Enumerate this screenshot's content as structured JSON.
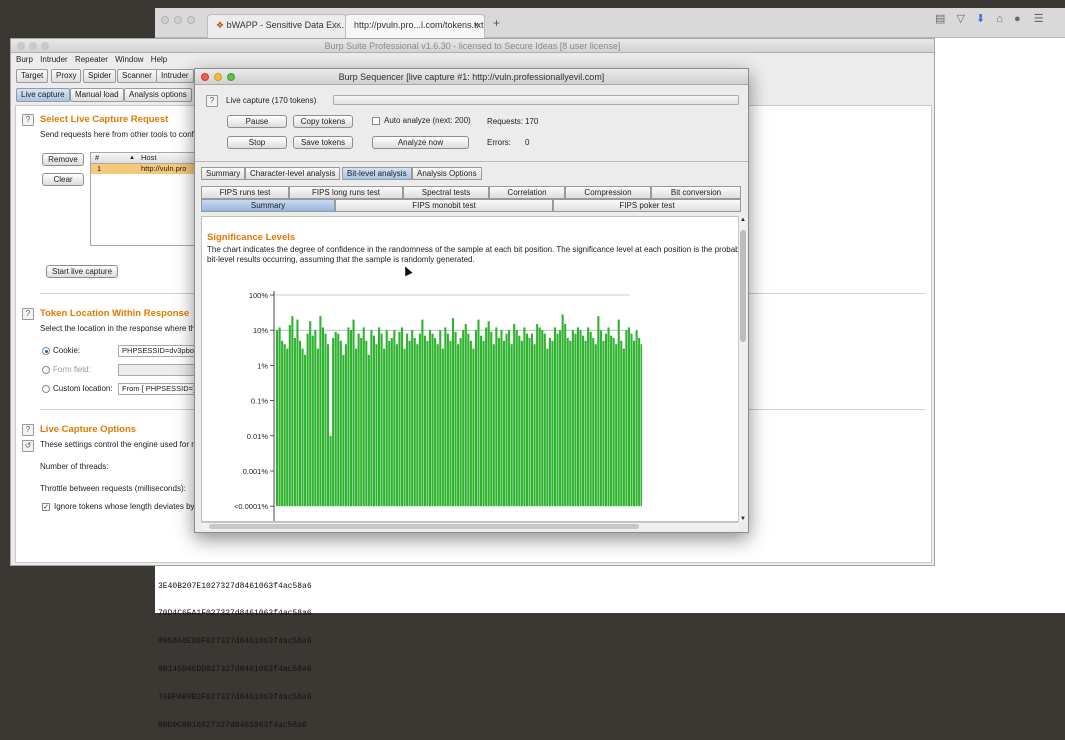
{
  "browser": {
    "tabs": [
      {
        "label": "bWAPP - Sensitive Data Ex...",
        "close": "×"
      },
      {
        "label": "http://pvuln.pro...l.com/tokens.txt",
        "close": "×"
      }
    ],
    "new_tab": "+",
    "token_lines": [
      "3E40B207E1027327d8461063f4ac58a6",
      "70D4C6EA1F027327d8461063f4ac58a6",
      "095868E86F027327d8461063f4ac58a6",
      "9B145D46DD027327d8461063f4ac58a6",
      "76BPAB9B3F027327d8461063f4ac58a6",
      "8BD0C0B16027327d8461063f4ac58a6"
    ]
  },
  "burp": {
    "title": "Burp Suite Professional v1.6.30 - licensed to Secure Ideas [8 user license]",
    "menu": [
      "Burp",
      "Intruder",
      "Repeater",
      "Window",
      "Help"
    ],
    "main_tabs": [
      "Target",
      "Proxy",
      "Spider",
      "Scanner",
      "Intruder"
    ],
    "sub_tabs": [
      "Live capture",
      "Manual load",
      "Analysis options"
    ],
    "select_section": {
      "title": "Select Live Capture Request",
      "desc": "Send requests here from other tools to conf",
      "remove": "Remove",
      "clear": "Clear",
      "col_num": "#",
      "col_host": "Host",
      "row_num": "1",
      "row_host": "http://vuln.pro",
      "start": "Start live capture"
    },
    "token_section": {
      "title": "Token Location Within Response",
      "desc": "Select the location in the response where the",
      "cookie_label": "Cookie:",
      "cookie_value": "PHPSESSID=dv3pboa",
      "form_label": "Form field:",
      "custom_label": "Custom location:",
      "custom_value": "From [ PHPSESSID=] to"
    },
    "options_section": {
      "title": "Live Capture Options",
      "desc": "These settings control the engine used for m",
      "threads": "Number of threads:",
      "throttle": "Throttle between requests (milliseconds):",
      "ignore": "Ignore tokens whose length deviates by"
    }
  },
  "sequencer": {
    "title": "Burp Sequencer [live capture #1: http://vuln.professionallyevil.com]",
    "capture_status": "Live capture (170 tokens)",
    "pause": "Pause",
    "copy_tokens": "Copy tokens",
    "stop": "Stop",
    "save_tokens": "Save tokens",
    "auto_analyze": "Auto analyze (next: 200)",
    "analyze_now": "Analyze now",
    "requests_label": "Requests:",
    "requests_value": "170",
    "errors_label": "Errors:",
    "errors_value": "0",
    "analysis_tabs": [
      "Summary",
      "Character-level analysis",
      "Bit-level analysis",
      "Analysis Options"
    ],
    "test_tabs_row1": [
      "FIPS runs test",
      "FIPS long runs test",
      "Spectral tests",
      "Correlation",
      "Compression",
      "Bit conversion"
    ],
    "test_tabs_row2": [
      "Summary",
      "FIPS monobit test",
      "FIPS poker test"
    ],
    "heading": "Significance Levels",
    "description_1": "The chart indicates the degree of confidence in the randomness of the sample at each bit position. The significance level at each position is the probab",
    "description_2": "bit-level results occurring, assuming that the sample is randomly generated."
  },
  "colors": {
    "accent": "#e07a00",
    "bar": "#2eb32e",
    "selected_tab": "#a9c3e4"
  },
  "chart_data": {
    "type": "bar",
    "y_scale": "log",
    "ylim": [
      1e-06,
      1
    ],
    "y_ticks": [
      "100%",
      "10%",
      "1%",
      "0.1%",
      "0.01%",
      "0.001%",
      "<0.0001%"
    ],
    "grid": true,
    "values": [
      0.1,
      0.12,
      0.05,
      0.04,
      0.03,
      0.14,
      0.25,
      0.06,
      0.2,
      0.05,
      0.03,
      0.02,
      0.08,
      0.18,
      0.07,
      0.1,
      0.03,
      0.25,
      0.12,
      0.08,
      0.04,
      0.0001,
      0.06,
      0.09,
      0.08,
      0.05,
      0.02,
      0.04,
      0.12,
      0.1,
      0.2,
      0.03,
      0.08,
      0.06,
      0.12,
      0.05,
      0.02,
      0.1,
      0.07,
      0.04,
      0.12,
      0.08,
      0.03,
      0.1,
      0.05,
      0.06,
      0.1,
      0.04,
      0.09,
      0.12,
      0.03,
      0.08,
      0.05,
      0.1,
      0.06,
      0.04,
      0.08,
      0.2,
      0.07,
      0.05,
      0.1,
      0.08,
      0.06,
      0.04,
      0.1,
      0.03,
      0.12,
      0.08,
      0.05,
      0.22,
      0.09,
      0.04,
      0.06,
      0.1,
      0.15,
      0.08,
      0.05,
      0.03,
      0.1,
      0.2,
      0.07,
      0.05,
      0.12,
      0.18,
      0.09,
      0.04,
      0.12,
      0.06,
      0.1,
      0.05,
      0.08,
      0.1,
      0.04,
      0.15,
      0.1,
      0.07,
      0.05,
      0.12,
      0.08,
      0.06,
      0.08,
      0.04,
      0.15,
      0.12,
      0.1,
      0.08,
      0.03,
      0.06,
      0.05,
      0.12,
      0.08,
      0.1,
      0.28,
      0.15,
      0.06,
      0.05,
      0.1,
      0.08,
      0.12,
      0.1,
      0.07,
      0.05,
      0.12,
      0.09,
      0.06,
      0.04,
      0.25,
      0.1,
      0.05,
      0.08,
      0.12,
      0.07,
      0.06,
      0.04,
      0.2,
      0.05,
      0.03,
      0.1,
      0.12,
      0.08,
      0.05,
      0.1,
      0.06,
      0.04,
      0.08,
      0.1,
      0.15,
      0.07,
      0.05,
      0.09,
      0.12,
      0.06,
      0.03,
      0.08,
      0.04,
      0.25,
      0.1,
      0.05,
      0.03,
      0.15,
      0.1,
      0.12
    ]
  }
}
